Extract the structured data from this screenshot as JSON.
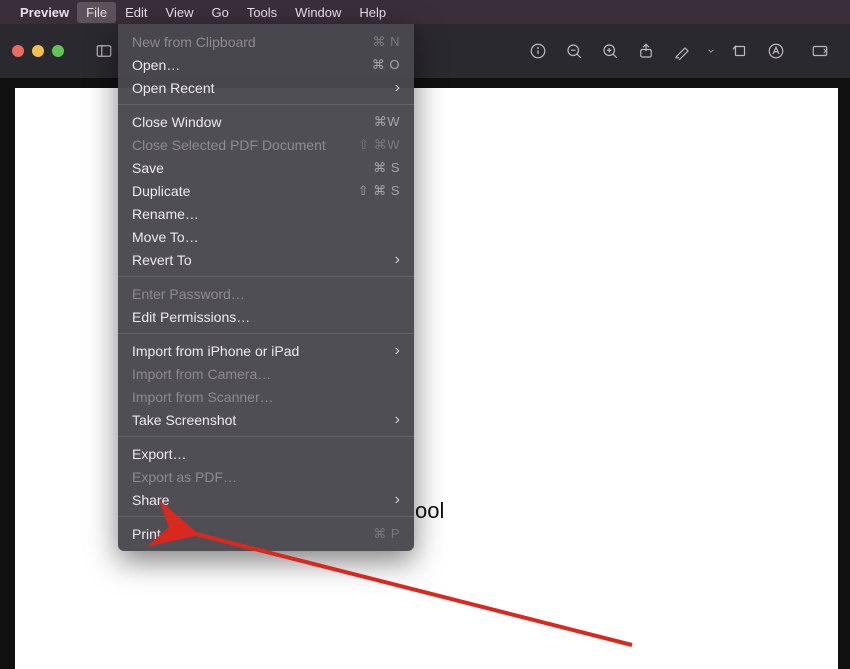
{
  "menubar": {
    "app_name": "Preview",
    "items": [
      {
        "label": "File",
        "active": true
      },
      {
        "label": "Edit"
      },
      {
        "label": "View"
      },
      {
        "label": "Go"
      },
      {
        "label": "Tools"
      },
      {
        "label": "Window"
      },
      {
        "label": "Help"
      }
    ]
  },
  "dropdown": {
    "groups": [
      [
        {
          "label": "New from Clipboard",
          "shortcut": "⌘ N",
          "disabled": true
        },
        {
          "label": "Open…",
          "shortcut": "⌘ O"
        },
        {
          "label": "Open Recent",
          "submenu": true
        }
      ],
      [
        {
          "label": "Close Window",
          "shortcut": "⌘W"
        },
        {
          "label": "Close Selected PDF Document",
          "shortcut": "⇧ ⌘W",
          "disabled": true,
          "shortcut_dim": true
        },
        {
          "label": "Save",
          "shortcut": "⌘ S"
        },
        {
          "label": "Duplicate",
          "shortcut": "⇧ ⌘ S"
        },
        {
          "label": "Rename…"
        },
        {
          "label": "Move To…"
        },
        {
          "label": "Revert To",
          "submenu": true
        }
      ],
      [
        {
          "label": "Enter Password…",
          "disabled": true
        },
        {
          "label": "Edit Permissions…"
        }
      ],
      [
        {
          "label": "Import from iPhone or iPad",
          "submenu": true
        },
        {
          "label": "Import from Camera…",
          "disabled": true
        },
        {
          "label": "Import from Scanner…",
          "disabled": true
        },
        {
          "label": "Take Screenshot",
          "submenu": true
        }
      ],
      [
        {
          "label": "Export…"
        },
        {
          "label": "Export as PDF…",
          "disabled": true
        },
        {
          "label": "Share",
          "submenu": true
        }
      ],
      [
        {
          "label": "Print…",
          "shortcut": "⌘ P",
          "shortcut_dim": true
        }
      ]
    ]
  },
  "document": {
    "visible_text_fragment": "ool"
  },
  "annotation": {
    "type": "arrow",
    "color": "#d9281e"
  }
}
